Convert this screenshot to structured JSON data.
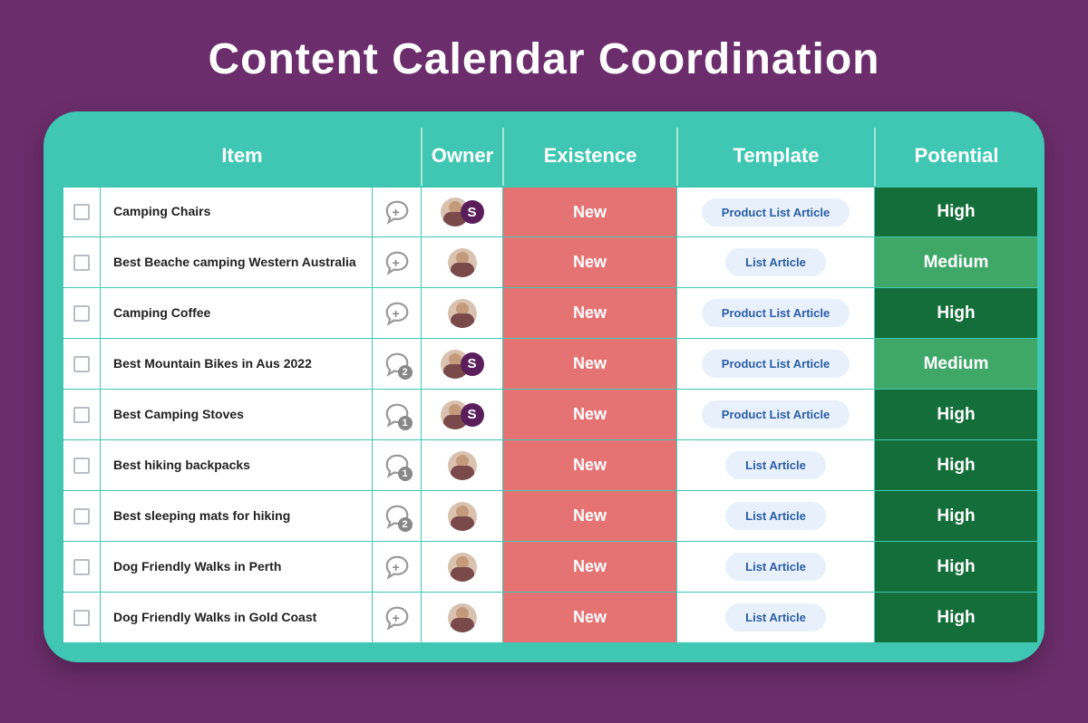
{
  "title": "Content Calendar Coordination",
  "columns": {
    "item": "Item",
    "owner": "Owner",
    "existence": "Existence",
    "template": "Template",
    "potential": "Potential"
  },
  "templates": {
    "product_list": "Product List Article",
    "list": "List Article"
  },
  "existence_labels": {
    "new": "New"
  },
  "potential_labels": {
    "high": "High",
    "medium": "Medium"
  },
  "owner_badge_letter": "S",
  "rows": [
    {
      "item": "Camping Chairs",
      "comment": "+",
      "owner_extra": true,
      "existence": "new",
      "template": "product_list",
      "potential": "high"
    },
    {
      "item": "Best Beache camping Western Australia",
      "comment": "+",
      "owner_extra": false,
      "existence": "new",
      "template": "list",
      "potential": "medium"
    },
    {
      "item": "Camping Coffee",
      "comment": "+",
      "owner_extra": false,
      "existence": "new",
      "template": "product_list",
      "potential": "high"
    },
    {
      "item": "Best Mountain Bikes in Aus 2022",
      "comment": "2",
      "owner_extra": true,
      "existence": "new",
      "template": "product_list",
      "potential": "medium"
    },
    {
      "item": "Best Camping Stoves",
      "comment": "1",
      "owner_extra": true,
      "existence": "new",
      "template": "product_list",
      "potential": "high"
    },
    {
      "item": "Best hiking backpacks",
      "comment": "1",
      "owner_extra": false,
      "existence": "new",
      "template": "list",
      "potential": "high"
    },
    {
      "item": "Best sleeping mats for hiking",
      "comment": "2",
      "owner_extra": false,
      "existence": "new",
      "template": "list",
      "potential": "high"
    },
    {
      "item": "Dog Friendly Walks in Perth",
      "comment": "+",
      "owner_extra": false,
      "existence": "new",
      "template": "list",
      "potential": "high"
    },
    {
      "item": "Dog Friendly Walks in Gold Coast",
      "comment": "+",
      "owner_extra": false,
      "existence": "new",
      "template": "list",
      "potential": "high"
    }
  ]
}
